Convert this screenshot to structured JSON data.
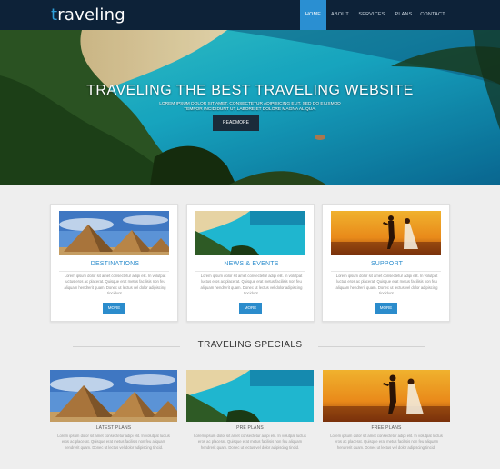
{
  "nav": {
    "logo_first": "t",
    "logo_rest": "raveling",
    "items": [
      "HOME",
      "ABOUT",
      "SERVICES",
      "PLANS",
      "CONTACT"
    ]
  },
  "hero": {
    "title": "TRAVELING THE BEST TRAVELING WEBSITE",
    "subtitle_line1": "LOREM IPSUM DOLOR SIT AMET, CONSECTETUR ADIPISICING ELIT, SED DO EIUSMOD",
    "subtitle_line2": "TEMPOR INCIDIDUNT UT LABORE ET DOLORE MAGNA ALIQUA.",
    "button": "READMORE"
  },
  "cards": [
    {
      "title": "DESTINATIONS",
      "text": "Lorem ipsum dolor sit amet consectetur adipi elit. In volutpat luctus eros ac placerat. Quisque erat metus facilisis non feu aliquam hendrerit quam. Donec ut lectus vel dolor adipiscing tincidunt.",
      "button": "MORE"
    },
    {
      "title": "NEWS & EVENTS",
      "text": "Lorem ipsum dolor sit amet consectetur adipi elit. In volutpat luctus eros ac placerat. Quisque erat metus facilisis non feu aliquam hendrerit quam. Donec ut lectus vel dolor adipiscing tincidunt.",
      "button": "MORE"
    },
    {
      "title": "SUPPORT",
      "text": "Lorem ipsum dolor sit amet consectetur adipi elit. In volutpat luctus eros ac placerat. Quisque erat metus facilisis non feu aliquam hendrerit quam. Donec ut lectus vel dolor adipiscing tincidunt.",
      "button": "MORE"
    }
  ],
  "specials": {
    "title": "TRAVELING SPECIALS",
    "items": [
      {
        "title": "LATEST PLANS",
        "text": "Lorem ipsum dolor sit amet consectetur adipi elit. In volutpat luctus eros ac placerat. Quisque erat metus facilisis non feu aliquam hendrerit quam. Donec ut lectus vel dolor adipiscing tincid."
      },
      {
        "title": "PRE PLANS",
        "text": "Lorem ipsum dolor sit amet consectetur adipi elit. In volutpat luctus eros ac placerat. Quisque erat metus facilisis non feu aliquam hendrerit quam. Donec ut lectus vel dolor adipiscing tincid."
      },
      {
        "title": "FREE PLANS",
        "text": "Lorem ipsum dolor sit amet consectetur adipi elit. In volutpat luctus eros ac placerat. Quisque erat metus facilisis non feu aliquam hendrerit quam. Donec ut lectus vel dolor adipiscing tincid."
      }
    ]
  },
  "colors": {
    "nav_bg": "#0d2238",
    "accent": "#2b8ccc",
    "page_bg": "#eeeeee"
  }
}
